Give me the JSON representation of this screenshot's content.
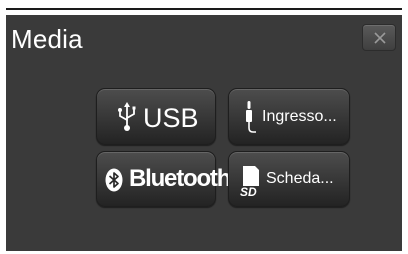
{
  "screen": {
    "title": "Media",
    "close_icon": "close-x-icon"
  },
  "sources": [
    {
      "id": "usb",
      "label": "USB",
      "icon": "usb-icon"
    },
    {
      "id": "aux",
      "label": "Ingresso...",
      "icon": "audio-jack-icon"
    },
    {
      "id": "bluetooth",
      "label": "Bluetooth",
      "icon": "bluetooth-icon"
    },
    {
      "id": "sd",
      "label": "Scheda...",
      "icon": "sd-card-icon"
    }
  ],
  "colors": {
    "background": "#3a3a3a",
    "text": "#ffffff",
    "tile_top": "#4d4d4d",
    "tile_bottom": "#232323"
  }
}
